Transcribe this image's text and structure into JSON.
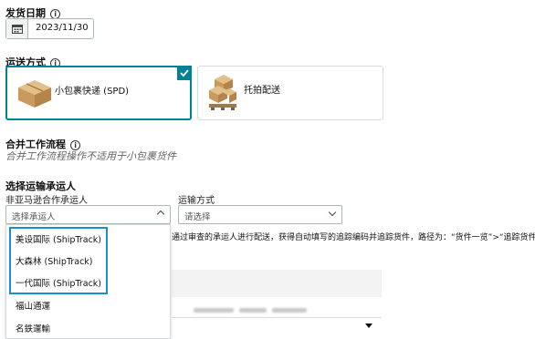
{
  "ship_date": {
    "label": "发货日期",
    "value": "2023/11/30"
  },
  "shipping_method": {
    "label": "运送方式",
    "options": [
      {
        "label": "小包裹快递 (SPD)",
        "selected": true
      },
      {
        "label": "托拍配送",
        "selected": false
      }
    ]
  },
  "merge_workflow": {
    "label": "合并工作流程",
    "hint": "合并工作流程操作不适用于小包裹货件"
  },
  "carrier": {
    "section_label": "选择运输承运人",
    "partner_label": "非亚马逊合作承运人",
    "partner_placeholder": "选择承运人",
    "method_label": "运输方式",
    "method_placeholder": "请选择",
    "info_text": "通过审查的承运人进行配送，获得自动填写的追踪编码并追踪货件，路径为：“货件一览”>“追踪货件”。",
    "dropdown_options": [
      "美设国际 (ShipTrack)",
      "大森林 (ShipTrack)",
      "一代国际 (ShipTrack)",
      "福山通運",
      "名鉄運輸"
    ]
  },
  "colors": {
    "accent": "#008296",
    "highlight_border": "#1a8fc9"
  }
}
